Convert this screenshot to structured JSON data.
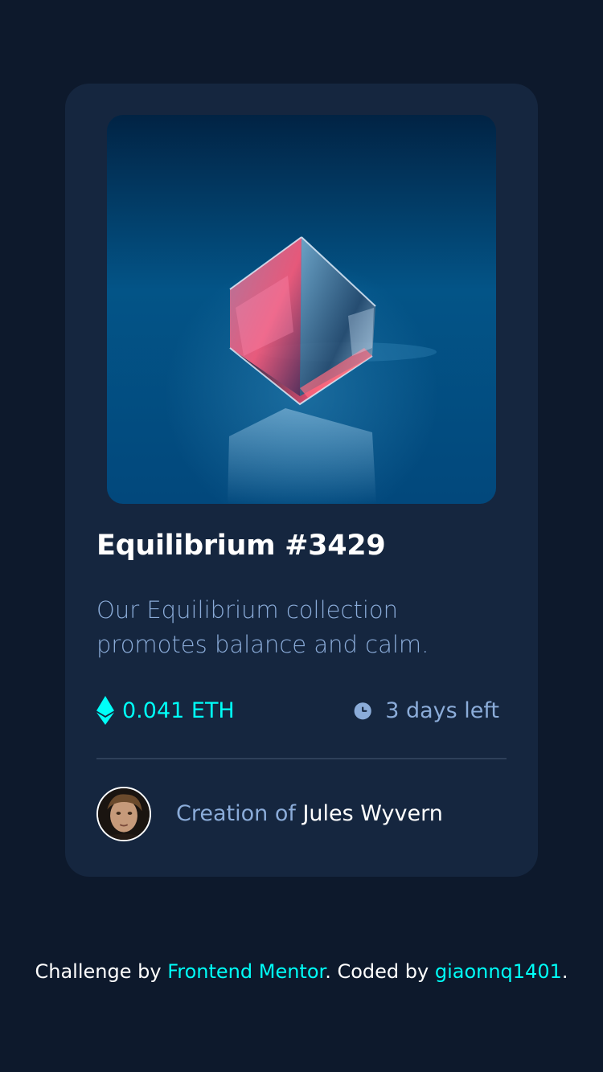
{
  "card": {
    "title": "Equilibrium #3429",
    "description": "Our Equilibrium collection promotes balance and calm.",
    "price": "0.041 ETH",
    "time_left": "3 days left",
    "creator_prefix": "Creation of",
    "creator_name": "Jules Wyvern"
  },
  "footer": {
    "prefix": "Challenge by",
    "link1": "Frontend Mentor",
    "middle": ". Coded by",
    "link2": "giaonnq1401",
    "suffix": "."
  },
  "icons": {
    "price": "ethereum-icon",
    "time": "clock-icon"
  },
  "colors": {
    "page_bg": "#0d192c",
    "card_bg": "#15263f",
    "accent_cyan": "#00fff8",
    "soft_blue": "#8bacd9",
    "white": "#ffffff",
    "divider": "#2e405a"
  }
}
